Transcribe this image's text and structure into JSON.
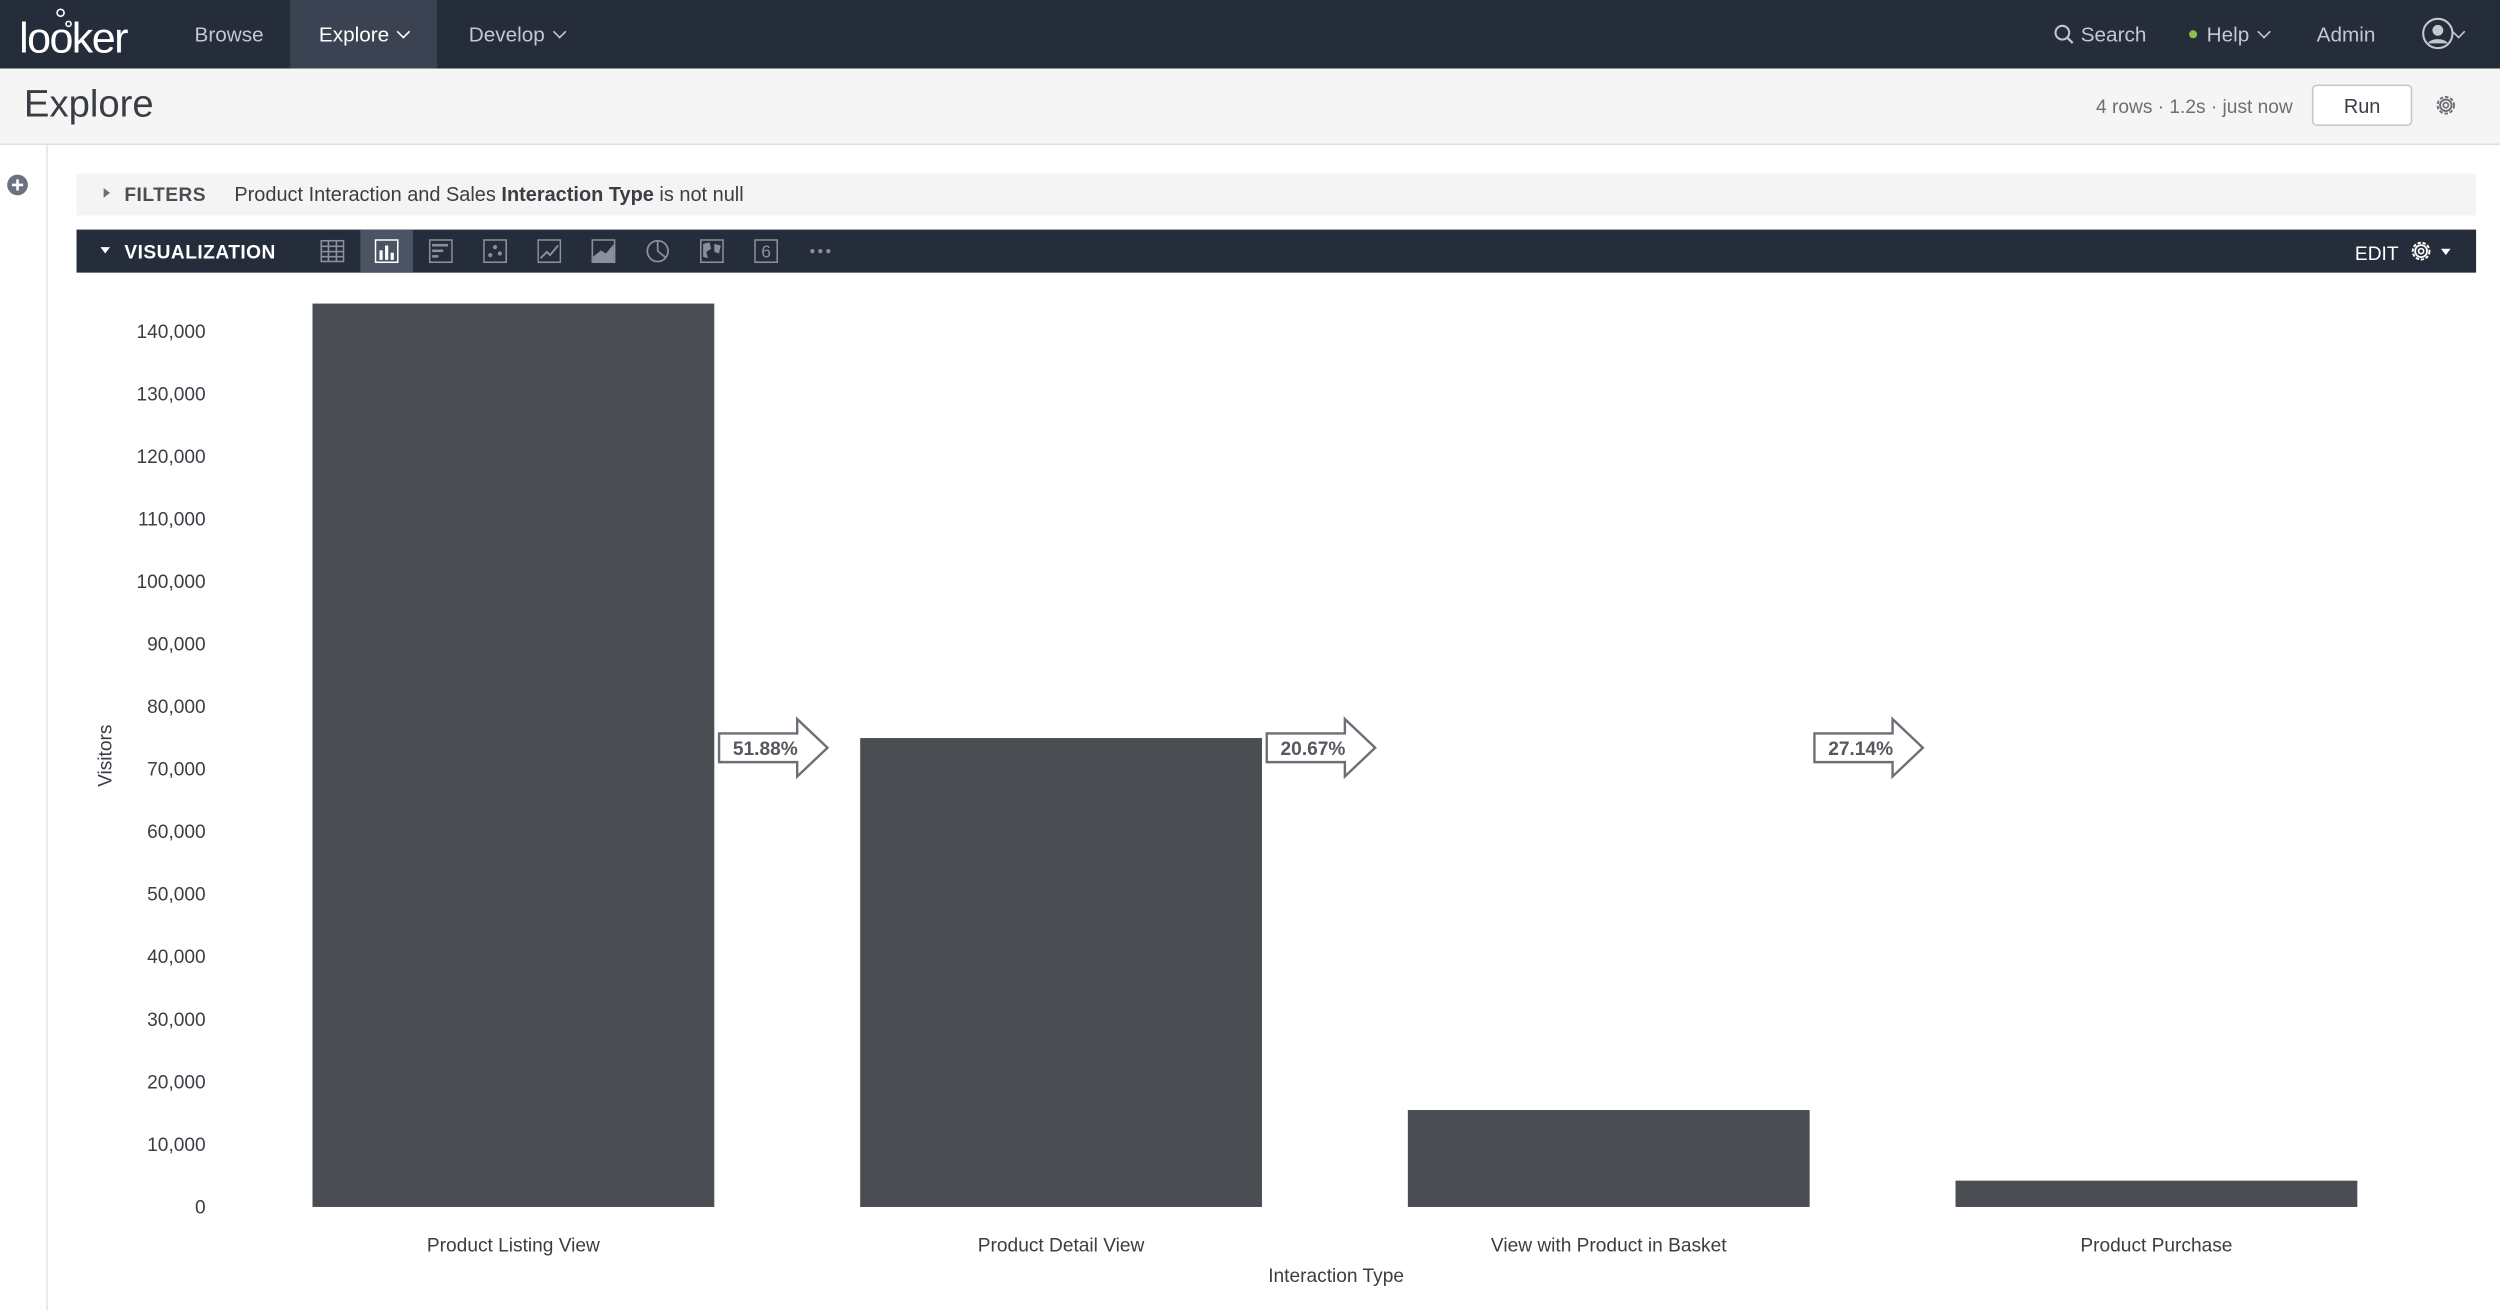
{
  "nav": {
    "logo": "looker",
    "items": [
      {
        "label": "Browse",
        "active": false
      },
      {
        "label": "Explore",
        "active": true
      },
      {
        "label": "Develop",
        "active": false
      }
    ],
    "search_label": "Search",
    "help_label": "Help",
    "admin_label": "Admin"
  },
  "header": {
    "title": "Explore",
    "run_status": "4 rows · 1.2s · just now",
    "run_button": "Run"
  },
  "filters": {
    "label": "FILTERS",
    "text_prefix": "Product Interaction and Sales",
    "text_field": "Interaction Type",
    "text_suffix": "is not null"
  },
  "visualization": {
    "label": "VISUALIZATION",
    "edit_label": "EDIT",
    "icons": [
      "table-icon",
      "column-chart-icon",
      "bar-chart-icon",
      "scatter-icon",
      "line-icon",
      "area-icon",
      "pie-icon",
      "map-icon",
      "single-value-icon",
      "more-icon"
    ],
    "active_icon": "column-chart-icon",
    "single_value_glyph": "6",
    "more_glyph": "···"
  },
  "chart_data": {
    "type": "bar",
    "categories": [
      "Product Listing View",
      "Product Detail View",
      "View with Product in Basket",
      "Product Purchase"
    ],
    "values": [
      144500,
      75000,
      15500,
      4200
    ],
    "conversion_labels": [
      "51.88%",
      "20.67%",
      "27.14%"
    ],
    "xlabel": "Interaction Type",
    "ylabel": "Visitors",
    "ylim": [
      0,
      140000
    ],
    "yticks": [
      "140,000",
      "130,000",
      "120,000",
      "110,000",
      "100,000",
      "90,000",
      "80,000",
      "70,000",
      "60,000",
      "50,000",
      "40,000",
      "30,000",
      "20,000",
      "10,000",
      "0"
    ],
    "bar_color": "#4a4d52",
    "grid": false
  },
  "colors": {
    "nav_bg": "#262d3a",
    "nav_active": "#3b4352",
    "help_dot": "#8bc34a"
  }
}
